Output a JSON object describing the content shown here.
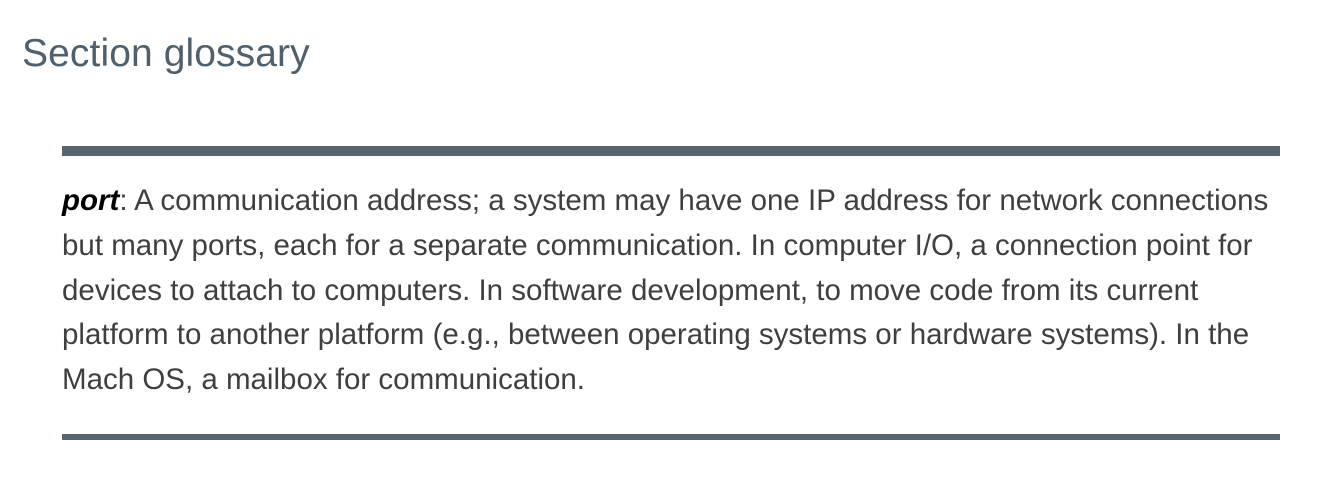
{
  "section": {
    "title": "Section glossary"
  },
  "glossary": {
    "entry": {
      "term": "port",
      "separator": ": ",
      "definition": "A communication address; a system may have one IP address for network connections but many ports, each for a separate communication. In computer I/O, a connection point for devices to attach to computers. In software development, to move code from its current platform to another platform (e.g., between operating systems or hardware systems). In the Mach OS, a mailbox for communication."
    }
  }
}
